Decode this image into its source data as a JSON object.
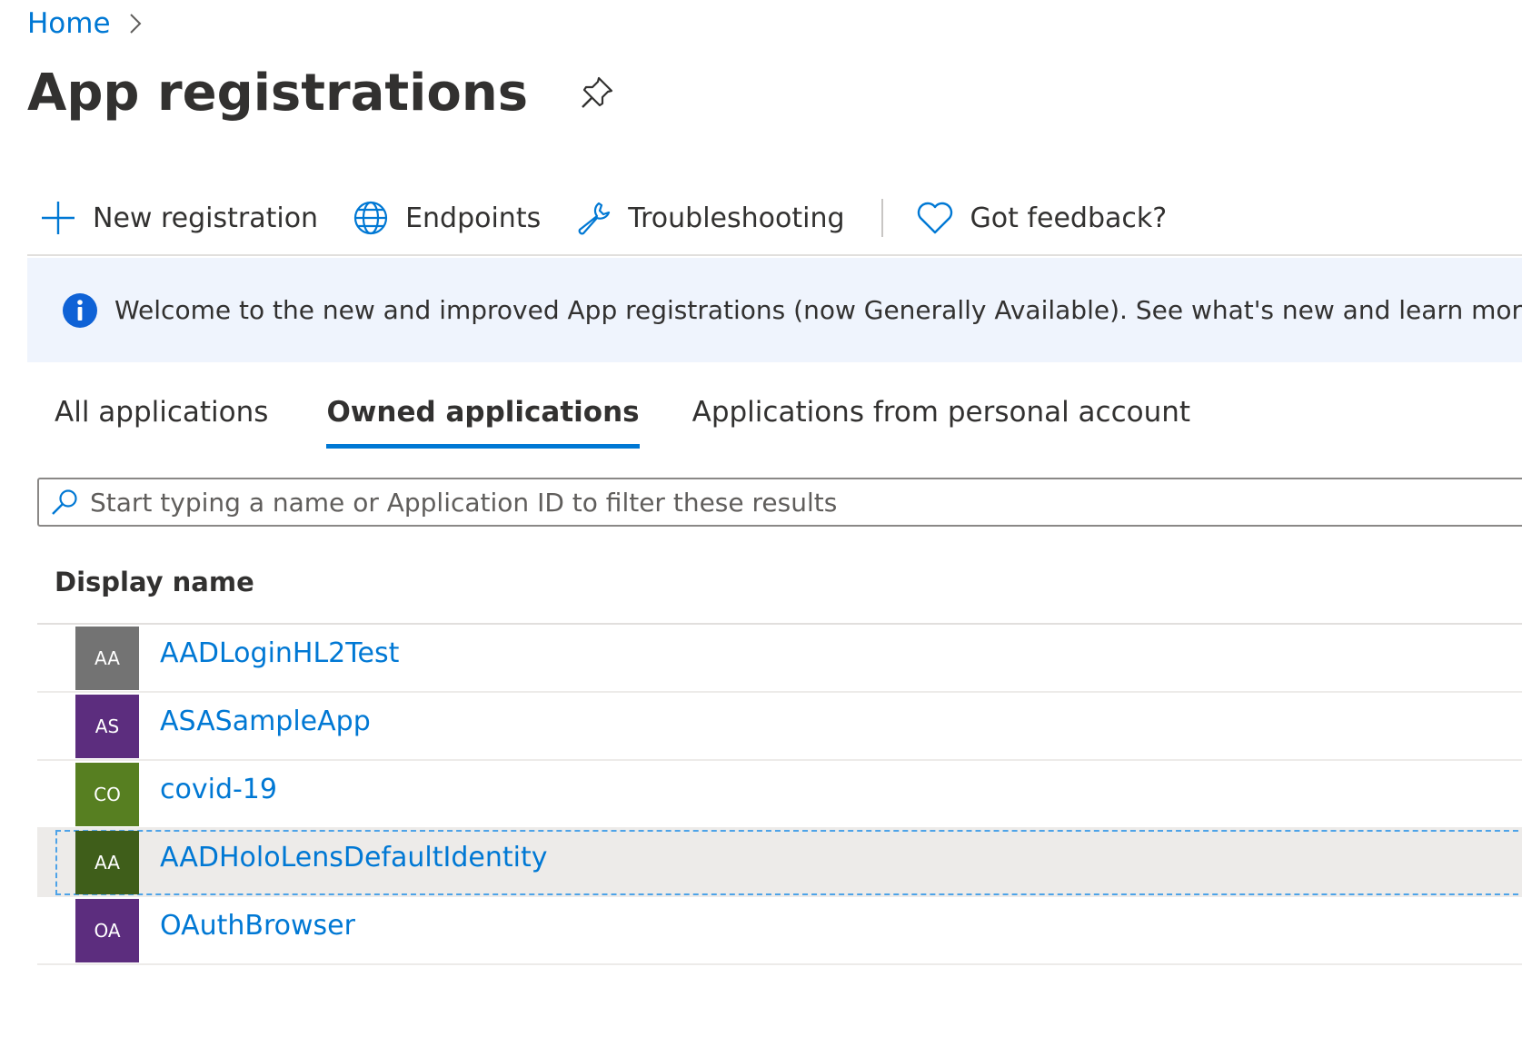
{
  "breadcrumb": {
    "home_label": "Home"
  },
  "header": {
    "title": "App registrations"
  },
  "toolbar": {
    "new_registration_label": "New registration",
    "endpoints_label": "Endpoints",
    "troubleshooting_label": "Troubleshooting",
    "feedback_label": "Got feedback?"
  },
  "banner": {
    "text": "Welcome to the new and improved App registrations (now Generally Available). See what's new and learn more on ho"
  },
  "tabs": [
    {
      "label": "All applications",
      "active": false
    },
    {
      "label": "Owned applications",
      "active": true
    },
    {
      "label": "Applications from personal account",
      "active": false
    }
  ],
  "search": {
    "placeholder": "Start typing a name or Application ID to filter these results",
    "value": ""
  },
  "table": {
    "columns": [
      "Display name"
    ],
    "rows": [
      {
        "initials": "AA",
        "name": "AADLoginHL2Test",
        "avatar_color": "#737373",
        "selected": false
      },
      {
        "initials": "AS",
        "name": "ASASampleApp",
        "avatar_color": "#5c2d7e",
        "selected": false
      },
      {
        "initials": "CO",
        "name": "covid-19",
        "avatar_color": "#577f21",
        "selected": false
      },
      {
        "initials": "AA",
        "name": "AADHoloLensDefaultIdentity",
        "avatar_color": "#3f5e1a",
        "selected": true
      },
      {
        "initials": "OA",
        "name": "OAuthBrowser",
        "avatar_color": "#5c2d7e",
        "selected": false
      }
    ]
  },
  "colors": {
    "accent": "#0078d4",
    "banner_bg": "#eff4fd",
    "selected_row_bg": "#edebe9"
  }
}
